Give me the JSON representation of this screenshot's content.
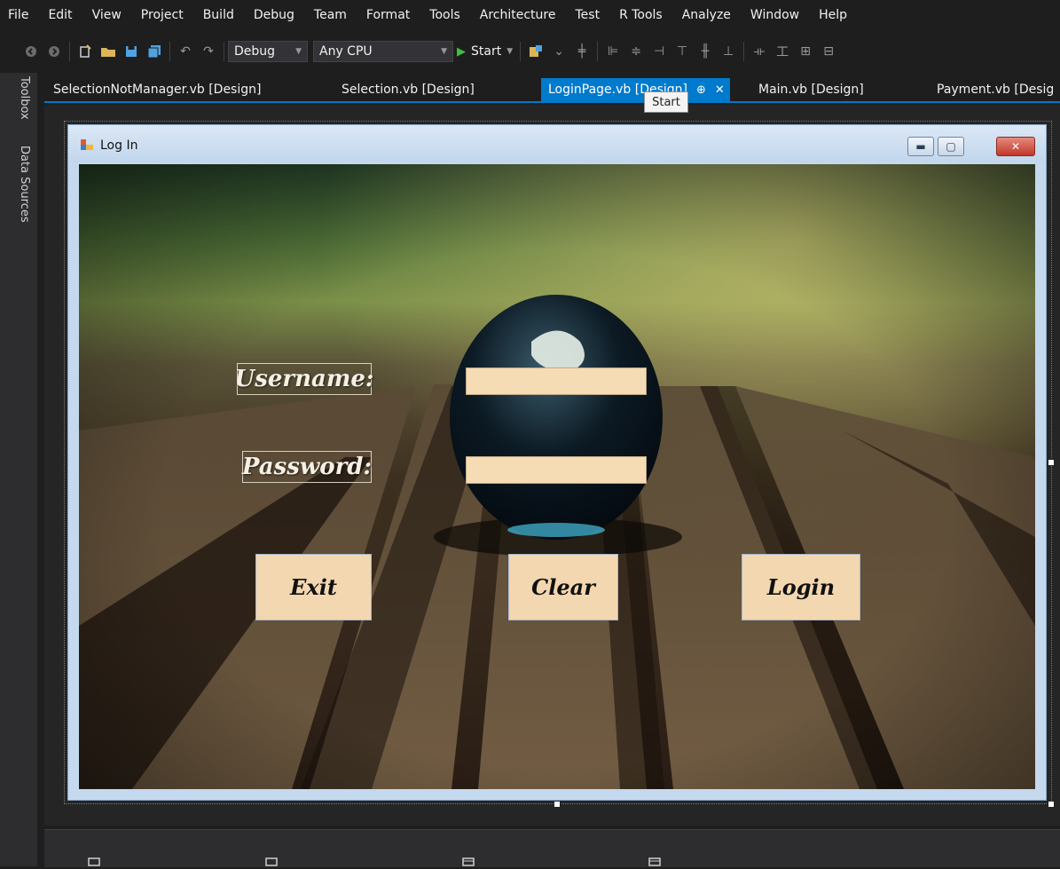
{
  "menu": [
    "File",
    "Edit",
    "View",
    "Project",
    "Build",
    "Debug",
    "Team",
    "Format",
    "Tools",
    "Architecture",
    "Test",
    "R Tools",
    "Analyze",
    "Window",
    "Help"
  ],
  "toolbar": {
    "config": "Debug",
    "platform": "Any CPU",
    "start_label": "Start"
  },
  "sidebar": {
    "toolbox": "Toolbox",
    "data_sources": "Data Sources"
  },
  "tabs": [
    {
      "label": "SelectionNotManager.vb [Design]"
    },
    {
      "label": "Selection.vb [Design]"
    },
    {
      "label": "LoginPage.vb [Design]",
      "active": true
    },
    {
      "label": "Main.vb [Design]"
    },
    {
      "label": "Payment.vb [Desig"
    }
  ],
  "tooltip": "Start",
  "form": {
    "title": "Log In",
    "username_label": "Username:",
    "password_label": "Password:",
    "username_value": "",
    "password_value": "",
    "exit_label": "Exit",
    "clear_label": "Clear",
    "login_label": "Login"
  },
  "colors": {
    "accent": "#007acc",
    "textbox": "#f5dcb4",
    "button": "#f3d7b0"
  }
}
